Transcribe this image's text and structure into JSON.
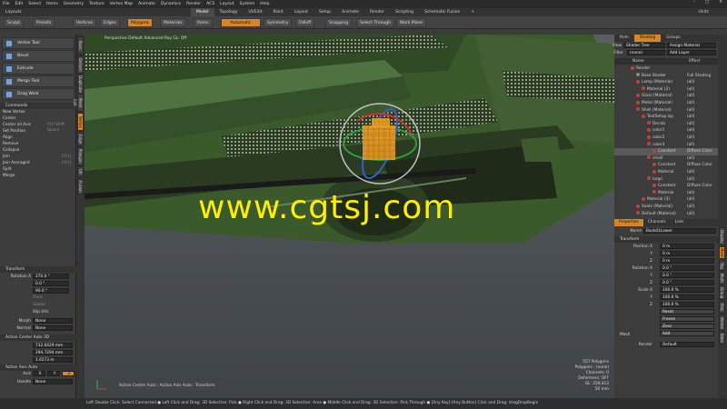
{
  "menu": [
    "File",
    "Edit",
    "Select",
    "Items",
    "Geometry",
    "Texture",
    "Vertex Map",
    "Animate",
    "Dynamics",
    "Render",
    "ACS",
    "Layout",
    "System",
    "Help"
  ],
  "window_controls": {
    "minimize": "–",
    "maximize": "□",
    "close": "✕"
  },
  "layout_dropdown": "Layouts",
  "layout_tabs": [
    "Model",
    "Topology",
    "UVEdit",
    "Paint",
    "Layout",
    "Setup",
    "Animate",
    "Render",
    "Scripting",
    "Schematic Fusion"
  ],
  "active_layout_tab": "Model",
  "add_tab": "+",
  "units_label": "Units",
  "toolbar": {
    "sculpt": "Sculpt",
    "presets": "Presets",
    "vertices": "Vertices",
    "edges": "Edges",
    "polygons": "Polygons",
    "materials": "Materials",
    "items": "Items",
    "automatic": "Automatic",
    "symmetry": "Symmetry",
    "falloff": "Falloff",
    "snapping": "Snapping",
    "select_through": "Select Through",
    "work_plane": "Work Plane"
  },
  "tools": [
    "Vertex Tool",
    "Bevel",
    "Extrude",
    "Merge Tool",
    "Drag Weld"
  ],
  "commands_header": "Commands",
  "commands": [
    "New Vertex",
    "Center",
    "Center all Axis",
    "Set Position",
    "Align",
    "Remove",
    "Collapse",
    "Join",
    "Join Averaged",
    "Split",
    "Merge"
  ],
  "commands_shortcuts": [
    "",
    "",
    "Ctrl Shift Space",
    "",
    "",
    "",
    "",
    "Ctrl J",
    "Ctrl J",
    "",
    ""
  ],
  "left_vtabs": [
    "Basic",
    "Deform",
    "Duplicate",
    "Mesh Edit",
    "Vertex",
    "Edge",
    "Polygon",
    "UV",
    "Fusion"
  ],
  "transform_header": "Transform",
  "transform": {
    "rotation_label": "Rotation X",
    "rx": "270.0 °",
    "ry": "0.0 °",
    "rz": "90.0 °",
    "pivot": "Pivot",
    "global": "Global",
    "slip_uvs": "Slip UVs",
    "morph_label": "Morph",
    "morph_value": "None",
    "normal_label": "Normal",
    "normal_value": "None"
  },
  "action_center_header": "Action Center Auto 3D",
  "action_center": {
    "x": "732.6429 mm",
    "y": "294.7294 mm",
    "z": "1.6573 m"
  },
  "action_axis_header": "Action Axis Auto",
  "action_axis": {
    "axis_label": "Axis",
    "x": "X",
    "y": "Y",
    "z": "Z",
    "handle_label": "Handle",
    "handle_value": "None"
  },
  "viewport": {
    "view_label": "Perspective",
    "mode": "Default",
    "style": "Advanced",
    "extra": "Ray GL: Off",
    "caption": "Action Center Auto : Action Axis Auto : Transform",
    "stats": [
      "557 Polygons",
      "Polygons : (none)",
      "Channels: 0",
      "Deformers: OFF",
      "GL: 259,413",
      "50 mm"
    ]
  },
  "watermark": "www.cgtsj.com",
  "shading_tabs": [
    "Item",
    "Shading",
    "Groups"
  ],
  "shading_header": {
    "view_label": "View",
    "view_value": "Shader Tree",
    "assign": "Assign Material",
    "filter_label": "Filter",
    "filter_value": "(none)",
    "add_layer": "Add Layer"
  },
  "shading_cols": {
    "name": "Name",
    "effect": "Effect"
  },
  "shader_tree": [
    {
      "name": "Render",
      "effect": "",
      "indent": 0,
      "color": "#c04040"
    },
    {
      "name": "Base Shader",
      "effect": "Full Shading",
      "indent": 1,
      "color": "#888"
    },
    {
      "name": "Lamp (Material)",
      "effect": "(all)",
      "indent": 1,
      "color": "#c04040"
    },
    {
      "name": "Material (2)",
      "effect": "(all)",
      "indent": 2,
      "color": "#c04040"
    },
    {
      "name": "Glass (Material)",
      "effect": "(all)",
      "indent": 1,
      "color": "#c04040"
    },
    {
      "name": "Metal (Material)",
      "effect": "(all)",
      "indent": 1,
      "color": "#c04040"
    },
    {
      "name": "Shell (Material)",
      "effect": "(all)",
      "indent": 1,
      "color": "#c04040"
    },
    {
      "name": "TextSetup.lxp",
      "effect": "(all)",
      "indent": 2,
      "color": "#c04040"
    },
    {
      "name": "Decals",
      "effect": "(all)",
      "indent": 3,
      "color": "#c04040"
    },
    {
      "name": "color1",
      "effect": "(all)",
      "indent": 3,
      "color": "#c04040"
    },
    {
      "name": "color2",
      "effect": "(all)",
      "indent": 3,
      "color": "#c04040"
    },
    {
      "name": "color3",
      "effect": "(all)",
      "indent": 3,
      "color": "#c04040"
    },
    {
      "name": "Constant",
      "effect": "Diffuse Color",
      "indent": 4,
      "color": "#c04040",
      "selected": true
    },
    {
      "name": "small",
      "effect": "(all)",
      "indent": 3,
      "color": "#c04040"
    },
    {
      "name": "Constant",
      "effect": "Diffuse Color",
      "indent": 4,
      "color": "#c04040"
    },
    {
      "name": "Material",
      "effect": "(all)",
      "indent": 4,
      "color": "#c04040"
    },
    {
      "name": "large",
      "effect": "(all)",
      "indent": 3,
      "color": "#c04040"
    },
    {
      "name": "Constant",
      "effect": "Diffuse Color",
      "indent": 4,
      "color": "#c04040"
    },
    {
      "name": "Material",
      "effect": "(all)",
      "indent": 4,
      "color": "#c04040"
    },
    {
      "name": "Material (3)",
      "effect": "(all)",
      "indent": 2,
      "color": "#c04040"
    },
    {
      "name": "Seats (Material)",
      "effect": "(all)",
      "indent": 1,
      "color": "#c04040"
    },
    {
      "name": "Default (Material)",
      "effect": "(all)",
      "indent": 1,
      "color": "#c04040"
    }
  ],
  "props_tabs": [
    "Properties",
    "Channels",
    "Lists"
  ],
  "props": {
    "name_label": "Name",
    "name_value": "Back01Lower",
    "transform_header": "Transform",
    "position_label": "Position X",
    "px": "0 m",
    "py": "0 m",
    "pz": "0 m",
    "rotation_label": "Rotation X",
    "rx": "0.0 °",
    "ry": "0.0 °",
    "rz": "0.0 °",
    "scale_label": "Scale X",
    "sx": "100.0 %",
    "sy": "100.0 %",
    "sz": "100.0 %",
    "axis_y": "Y",
    "axis_z": "Z",
    "reset": "Reset",
    "freeze": "Freeze",
    "zero": "Zero",
    "add": "Add",
    "mesh_header": "Mesh",
    "render_label": "Render",
    "render_value": "Default"
  },
  "right_vtabs": [
    "Display",
    "Mesh",
    "Tag",
    "Multi",
    "Group",
    "Poly",
    "Vertex",
    "Bake"
  ],
  "status": "Left Double Click: Select Connected ● Left Click and Drag: 3D Selection: Pick ● Right Click and Drag: 3D Selection: Area ● Middle Click and Drag: 3D Selection: Pick Through ● [Any Key]-[Any Button] Click and Drag: dragDropBegin"
}
